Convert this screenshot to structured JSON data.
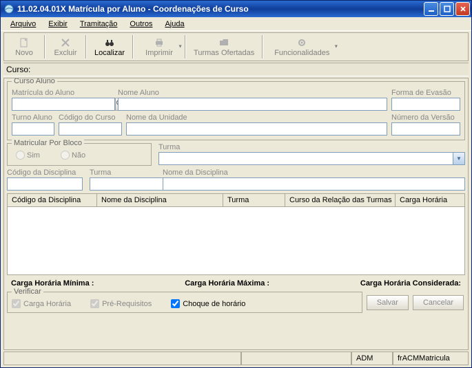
{
  "window": {
    "title": "11.02.04.01X Matrícula por Aluno - Coordenações de Curso"
  },
  "menu": {
    "arquivo": "Arquivo",
    "exibir": "Exibir",
    "tramitacao": "Tramitação",
    "outros": "Outros",
    "ajuda": "Ajuda"
  },
  "toolbar": {
    "novo": "Novo",
    "excluir": "Excluir",
    "localizar": "Localizar",
    "imprimir": "Imprimir",
    "turmas": "Turmas Ofertadas",
    "func": "Funcionalidades"
  },
  "curso_bar_label": "Curso:",
  "grp_curso_aluno": {
    "legend": "Curso Aluno",
    "matricula_lbl": "Matrícula do Aluno",
    "nome_aluno_lbl": "Nome Aluno",
    "forma_evasao_lbl": "Forma de Evasão",
    "turno_lbl": "Turno Aluno",
    "cod_curso_lbl": "Código do Curso",
    "nome_unidade_lbl": "Nome da Unidade",
    "num_versao_lbl": "Número da Versão"
  },
  "grp_matric_bloco": {
    "legend": "Matricular Por Bloco",
    "sim": "Sim",
    "nao": "Não"
  },
  "turma_lbl": "Turma",
  "cod_disc_lbl": "Código da Disciplina",
  "turma2_lbl": "Turma",
  "nome_disc_lbl": "Nome da Disciplina",
  "grid": {
    "c1": "Código da Disciplina",
    "c2": "Nome da Disciplina",
    "c3": "Turma",
    "c4": "Curso da Relação das Turmas",
    "c5": "Carga Horária"
  },
  "carga": {
    "min": "Carga Horária Mínima :",
    "max": "Carga Horária Máxima :",
    "cons": "Carga Horária Considerada:"
  },
  "verificar": {
    "legend": "Verificar",
    "ch": "Carga Horária",
    "pre": "Pré-Requisitos",
    "choque": "Choque de horário"
  },
  "buttons": {
    "salvar": "Salvar",
    "cancelar": "Cancelar"
  },
  "status": {
    "adm": "ADM",
    "form": "frACMMatricula"
  }
}
